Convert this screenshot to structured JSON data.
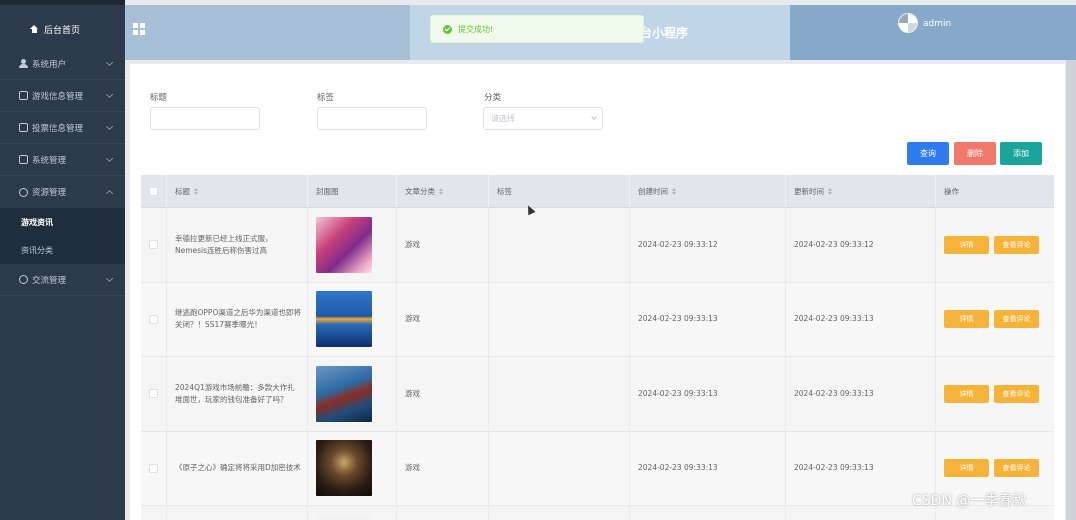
{
  "sidebar": {
    "home_label": "后台首页",
    "items": [
      {
        "label": "系统用户"
      },
      {
        "label": "游戏信息管理"
      },
      {
        "label": "投票信息管理"
      },
      {
        "label": "系统管理"
      },
      {
        "label": "资源管理"
      },
      {
        "label": "交流管理"
      }
    ],
    "sub_items": [
      {
        "label": "游戏资讯",
        "active": true
      },
      {
        "label": "资讯分类",
        "active": false
      }
    ]
  },
  "header": {
    "title": "台小程序",
    "username": "admin"
  },
  "toast": {
    "message": "提交成功!"
  },
  "filters": {
    "title_label": "标题",
    "tag_label": "标签",
    "category_label": "分类",
    "category_placeholder": "请选择"
  },
  "buttons": {
    "query": "查询",
    "delete": "删除",
    "add": "添加"
  },
  "table": {
    "headers": [
      "标题",
      "封面图",
      "文章分类",
      "标签",
      "创建时间",
      "更新时间",
      "操作"
    ],
    "rows": [
      {
        "title": "幸德拉更新已经上线正式服，Nemesis连胜后称伤害过高",
        "category": "游戏",
        "tag": "",
        "created": "2024-02-23 09:33:12",
        "updated": "2024-02-23 09:33:12"
      },
      {
        "title": "继逃跑OPPO渠道之后华为渠道也即将关闭？！SS17赛季曝光！",
        "category": "游戏",
        "tag": "",
        "created": "2024-02-23 09:33:13",
        "updated": "2024-02-23 09:33:13"
      },
      {
        "title": "2024Q1游戏市场前瞻：多款大作扎堆面世，玩家的钱包准备好了吗？",
        "category": "游戏",
        "tag": "",
        "created": "2024-02-23 09:33:13",
        "updated": "2024-02-23 09:33:13"
      },
      {
        "title": "《原子之心》确定将将采用D加密技术",
        "category": "游戏",
        "tag": "",
        "created": "2024-02-23 09:33:13",
        "updated": "2024-02-23 09:33:13"
      }
    ],
    "detail_label": "详情",
    "comment_label": "查看评论"
  },
  "watermark": "CSDN @一季春秋"
}
